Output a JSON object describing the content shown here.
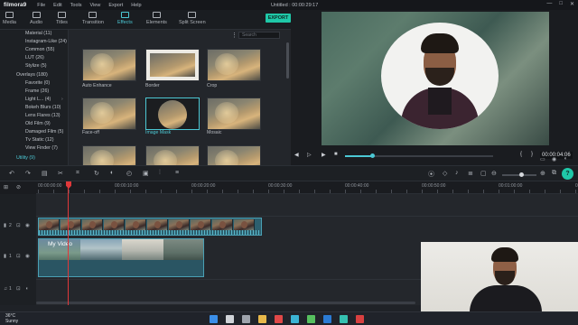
{
  "app": {
    "logo": "filmora9",
    "menu": [
      "File",
      "Edit",
      "Tools",
      "View",
      "Export",
      "Help"
    ],
    "title": "Untitled : 00:00:29:17",
    "window_controls": [
      "—",
      "□",
      "✕"
    ]
  },
  "top_tabs": [
    {
      "label": "Media",
      "icon": "folder-icon"
    },
    {
      "label": "Audio",
      "icon": "music-icon"
    },
    {
      "label": "Titles",
      "icon": "text-icon"
    },
    {
      "label": "Transition",
      "icon": "transition-icon"
    },
    {
      "label": "Effects",
      "icon": "effects-icon",
      "active": true
    },
    {
      "label": "Elements",
      "icon": "elements-icon"
    },
    {
      "label": "Split Screen",
      "icon": "split-screen-icon"
    }
  ],
  "export_label": "EXPORT",
  "categories": [
    {
      "label": "Material (11)"
    },
    {
      "label": "Instagram-Like (24)"
    },
    {
      "label": "Common (55)"
    },
    {
      "label": "LUT (26)"
    },
    {
      "label": "Stylize (5)"
    },
    {
      "label": "Overlays (180)"
    },
    {
      "label": "Favorite (0)"
    },
    {
      "label": "Frame (26)"
    },
    {
      "label": "Light L... (4)"
    },
    {
      "label": "Bokeh Blurs (10)"
    },
    {
      "label": "Lens Flares (13)"
    },
    {
      "label": "Old Film (9)"
    },
    {
      "label": "Damaged Film (5)"
    },
    {
      "label": "Tv Static (12)"
    },
    {
      "label": "View Finder (7)"
    },
    {
      "label": "Utility (9)",
      "active": true
    }
  ],
  "search_placeholder": "Search",
  "effects": [
    {
      "label": "Auto Enhance",
      "kind": "plain"
    },
    {
      "label": "Border",
      "kind": "border"
    },
    {
      "label": "Crop",
      "kind": "plain"
    },
    {
      "label": "Face-off",
      "kind": "plain"
    },
    {
      "label": "Image Mask",
      "kind": "mask",
      "selected": true
    },
    {
      "label": "Mosaic",
      "kind": "plain"
    },
    {
      "label": "",
      "kind": "plain"
    },
    {
      "label": "",
      "kind": "plain"
    },
    {
      "label": "",
      "kind": "plain"
    }
  ],
  "preview": {
    "time": "00:00:04:06",
    "playback_progress": 0.18,
    "controls": [
      "◀",
      "▷",
      "▶",
      "■"
    ],
    "braces": [
      "{",
      "}"
    ]
  },
  "timeline": {
    "ruler_labels": [
      "00:00:00:00",
      "00:00:10:00",
      "00:00:20:00",
      "00:00:30:00",
      "00:00:40:00",
      "00:00:50:00",
      "00:01:00:00",
      "00:01:10:00"
    ],
    "tracks": [
      {
        "number": "2"
      },
      {
        "number": "1"
      },
      {
        "number": "1"
      }
    ],
    "clip_v1_label": "My Video",
    "zoom_level": 0.55
  },
  "taskbar": {
    "temperature": "36°C",
    "weather": "Sunny"
  },
  "colors": {
    "accent": "#4cc8d4",
    "export": "#1fc8a8",
    "playhead": "#e0383a"
  }
}
